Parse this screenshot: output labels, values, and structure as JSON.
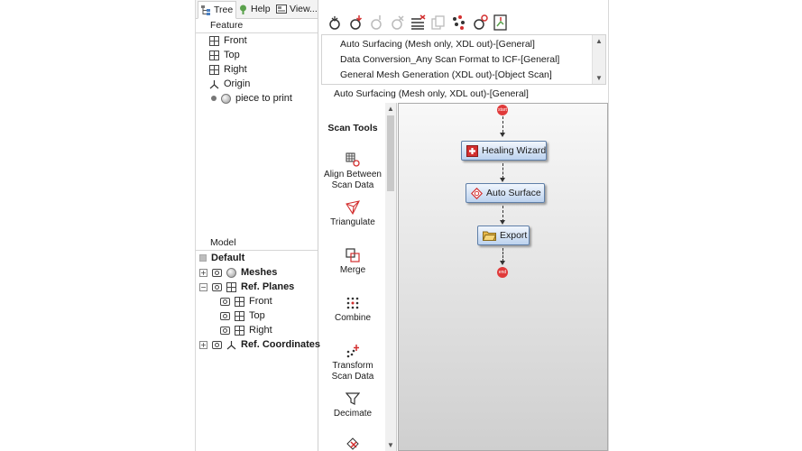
{
  "tabs": [
    {
      "label": "Tree",
      "icon": "tree-icon"
    },
    {
      "label": "Help",
      "icon": "help-icon"
    },
    {
      "label": "View...",
      "icon": "view-icon"
    }
  ],
  "feature": {
    "title": "Feature",
    "items": [
      {
        "label": "Front",
        "icon": "plane-icon"
      },
      {
        "label": "Top",
        "icon": "plane-icon"
      },
      {
        "label": "Right",
        "icon": "plane-icon"
      },
      {
        "label": "Origin",
        "icon": "origin-axes-icon"
      },
      {
        "label": "piece to print",
        "icon": "mesh-icon"
      }
    ]
  },
  "model": {
    "title": "Model",
    "default_label": "Default",
    "items": [
      {
        "label": "Meshes",
        "expander": "+"
      },
      {
        "label": "Ref. Planes",
        "expander": "−"
      },
      {
        "label": "Front"
      },
      {
        "label": "Top"
      },
      {
        "label": "Right"
      },
      {
        "label": "Ref. Coordinates",
        "expander": "+"
      }
    ]
  },
  "toolbar": {
    "icons": [
      "new-job-icon",
      "import-job-icon",
      "run-icon",
      "stop-icon",
      "delete-list-icon",
      "copy-icon",
      "cloud-points-icon",
      "settings-icon",
      "export-icon"
    ]
  },
  "jobs": {
    "items": [
      "Auto Surfacing (Mesh only, XDL out)-[General]",
      "Data Conversion_Any Scan Format to ICF-[General]",
      "General Mesh Generation (XDL out)-[Object Scan]"
    ],
    "selected": "Auto Surfacing (Mesh only, XDL out)-[General]"
  },
  "tools": {
    "title": "Scan Tools",
    "items": [
      {
        "label": "Align Between Scan Data",
        "icon": "align-icon"
      },
      {
        "label": "Triangulate",
        "icon": "triangulate-icon"
      },
      {
        "label": "Merge",
        "icon": "merge-icon"
      },
      {
        "label": "Combine",
        "icon": "combine-icon"
      },
      {
        "label": "Transform Scan Data",
        "icon": "transform-icon"
      },
      {
        "label": "Decimate",
        "icon": "decimate-icon"
      }
    ]
  },
  "flow": {
    "start_label": "start",
    "end_label": "end",
    "nodes": [
      {
        "label": "Healing Wizard",
        "icon": "healing-icon"
      },
      {
        "label": "Auto Surface",
        "icon": "auto-surface-icon"
      },
      {
        "label": "Export",
        "icon": "folder-icon"
      }
    ]
  },
  "colors": {
    "node_border": "#5f7fa8",
    "terminal": "#e03a3a",
    "accent_red": "#d32f2f"
  }
}
